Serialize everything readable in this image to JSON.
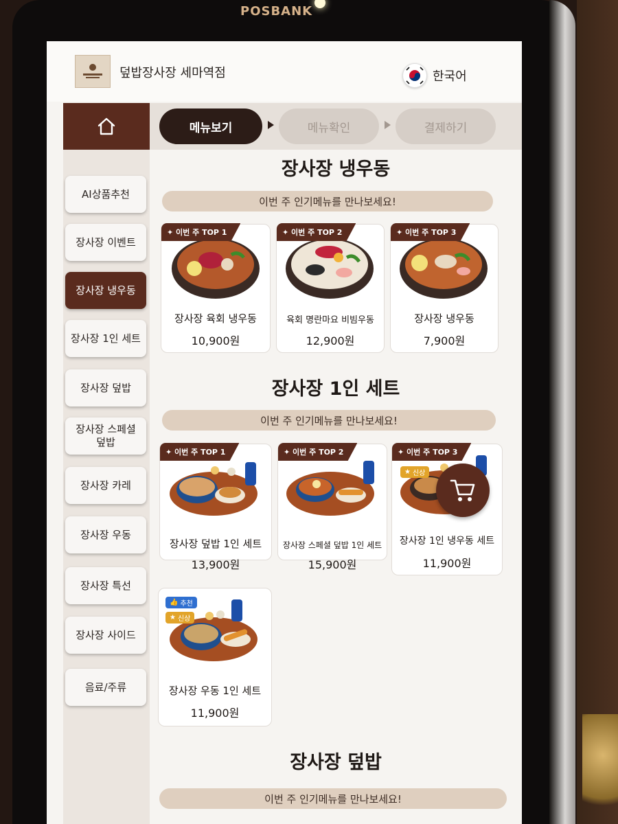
{
  "device": {
    "brand": "POSBANK"
  },
  "header": {
    "store_name": "덮밥장사장 세마역점",
    "language": "한국어",
    "logo_icon": "store-logo-icon"
  },
  "steps": [
    {
      "label": "메뉴보기",
      "active": true
    },
    {
      "label": "메뉴확인",
      "active": false
    },
    {
      "label": "결제하기",
      "active": false
    }
  ],
  "sidebar": {
    "home_icon": "home-icon",
    "categories": [
      {
        "label": "AI상품추천",
        "active": false
      },
      {
        "label": "장사장 이벤트",
        "active": false
      },
      {
        "label": "장사장 냉우동",
        "active": true
      },
      {
        "label": "장사장 1인 세트",
        "active": false
      },
      {
        "label": "장사장 덮밥",
        "active": false
      },
      {
        "label": "장사장 스페셜\n덮밥",
        "active": false
      },
      {
        "label": "장사장 카레",
        "active": false
      },
      {
        "label": "장사장 우동",
        "active": false
      },
      {
        "label": "장사장 특선",
        "active": false
      },
      {
        "label": "장사장 사이드",
        "active": false
      },
      {
        "label": "음료/주류",
        "active": false
      }
    ]
  },
  "sections": [
    {
      "title": "장사장 냉우동",
      "banner": "이번 주 인기메뉴를 만나보세요!",
      "items": [
        {
          "rank": "✦ 이번 주 TOP 1",
          "name": "장사장 육회 냉우동",
          "price": "10,900원"
        },
        {
          "rank": "✦ 이번 주 TOP 2",
          "name": "육회 명란마요 비빔우동",
          "price": "12,900원"
        },
        {
          "rank": "✦ 이번 주 TOP 3",
          "name": "장사장 냉우동",
          "price": "7,900원"
        }
      ]
    },
    {
      "title": "장사장 1인 세트",
      "banner": "이번 주 인기메뉴를 만나보세요!",
      "items": [
        {
          "rank": "✦ 이번 주 TOP 1",
          "name": "장사장 덮밥 1인 세트",
          "price": "13,900원"
        },
        {
          "rank": "✦ 이번 주 TOP 2",
          "name": "장사장 스페셜 덮밥 1인 세트",
          "price": "15,900원"
        },
        {
          "rank": "✦ 이번 주 TOP 3",
          "name": "장사장 1인 냉우동 세트",
          "price": "11,900원",
          "tags": [
            "신상"
          ]
        },
        {
          "rank": "",
          "name": "장사장 우동 1인 세트",
          "price": "11,900원",
          "tags": [
            "추천",
            "신상"
          ]
        }
      ]
    },
    {
      "title": "장사장 덮밥",
      "banner": "이번 주 인기메뉴를 만나보세요!",
      "items": []
    }
  ],
  "cart": {
    "icon": "cart-icon"
  },
  "colors": {
    "brand_brown": "#5a2b1e",
    "active_step": "#2c1c17",
    "banner": "#dfcfbf",
    "tag_blue": "#2f6fd0",
    "tag_gold": "#e2a42a"
  }
}
